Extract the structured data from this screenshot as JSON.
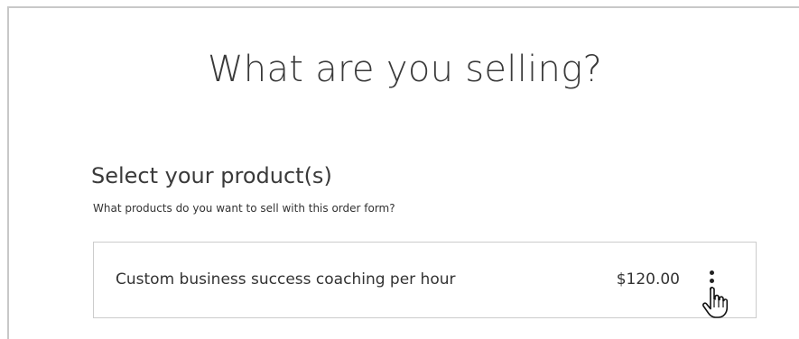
{
  "page": {
    "title": "What are you selling?"
  },
  "section": {
    "title": "Select your product(s)",
    "subtitle": "What products do you want to sell with this order form?"
  },
  "products": [
    {
      "name": "Custom business success coaching per hour",
      "price": "$120.00",
      "menu_icon": "more-vertical-icon"
    }
  ],
  "pointer": {
    "icon": "hand-pointer-icon"
  },
  "colors": {
    "border": "#cccccc",
    "text": "#333333",
    "frame": "#c8c8c8"
  }
}
